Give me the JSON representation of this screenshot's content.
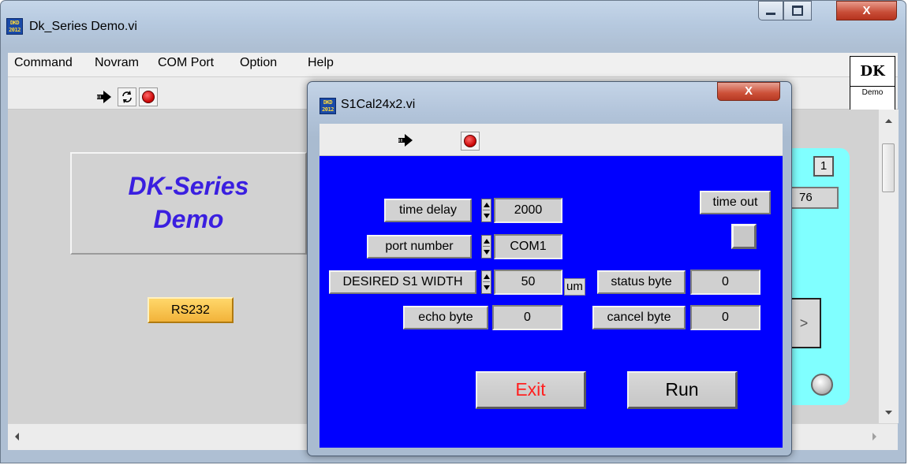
{
  "main_window": {
    "title": "Dk_Series Demo.vi",
    "controls": {
      "minimize": "▁",
      "maximize": "□",
      "close": "X"
    }
  },
  "menu": [
    "Command",
    "Novram",
    "COM Port",
    "Option",
    "Help"
  ],
  "logo": {
    "top": "DK",
    "bottom": "Demo"
  },
  "front_panel": {
    "title": "DK-Series\nDemo",
    "rs232_button": "RS232",
    "indicator_number": "1",
    "indicator_value": "76",
    "arrow_button": ">"
  },
  "dialog": {
    "title": "S1Cal24x2.vi",
    "close": "X",
    "time_delay_label": "time delay",
    "time_delay_value": "2000",
    "port_number_label": "port number",
    "port_number_value": "COM1",
    "desired_width_label": "DESIRED S1 WIDTH",
    "desired_width_value": "50",
    "desired_width_unit": "um",
    "echo_byte_label": "echo  byte",
    "echo_byte_value": "0",
    "time_out_label": "time out",
    "status_byte_label": "status byte",
    "status_byte_value": "0",
    "cancel_byte_label": "cancel byte",
    "cancel_byte_value": "0",
    "exit_label": "Exit",
    "run_label": "Run"
  },
  "colors": {
    "dialog_background": "#0000ff",
    "exit_text": "#ff2020",
    "title_text": "#3a1fe0",
    "rs232_button": "#f2b33a",
    "indicator_panel": "#80ffff"
  },
  "icons": [
    "labview-vi-icon",
    "run-arrow-icon",
    "run-continuous-icon",
    "stop-icon"
  ]
}
